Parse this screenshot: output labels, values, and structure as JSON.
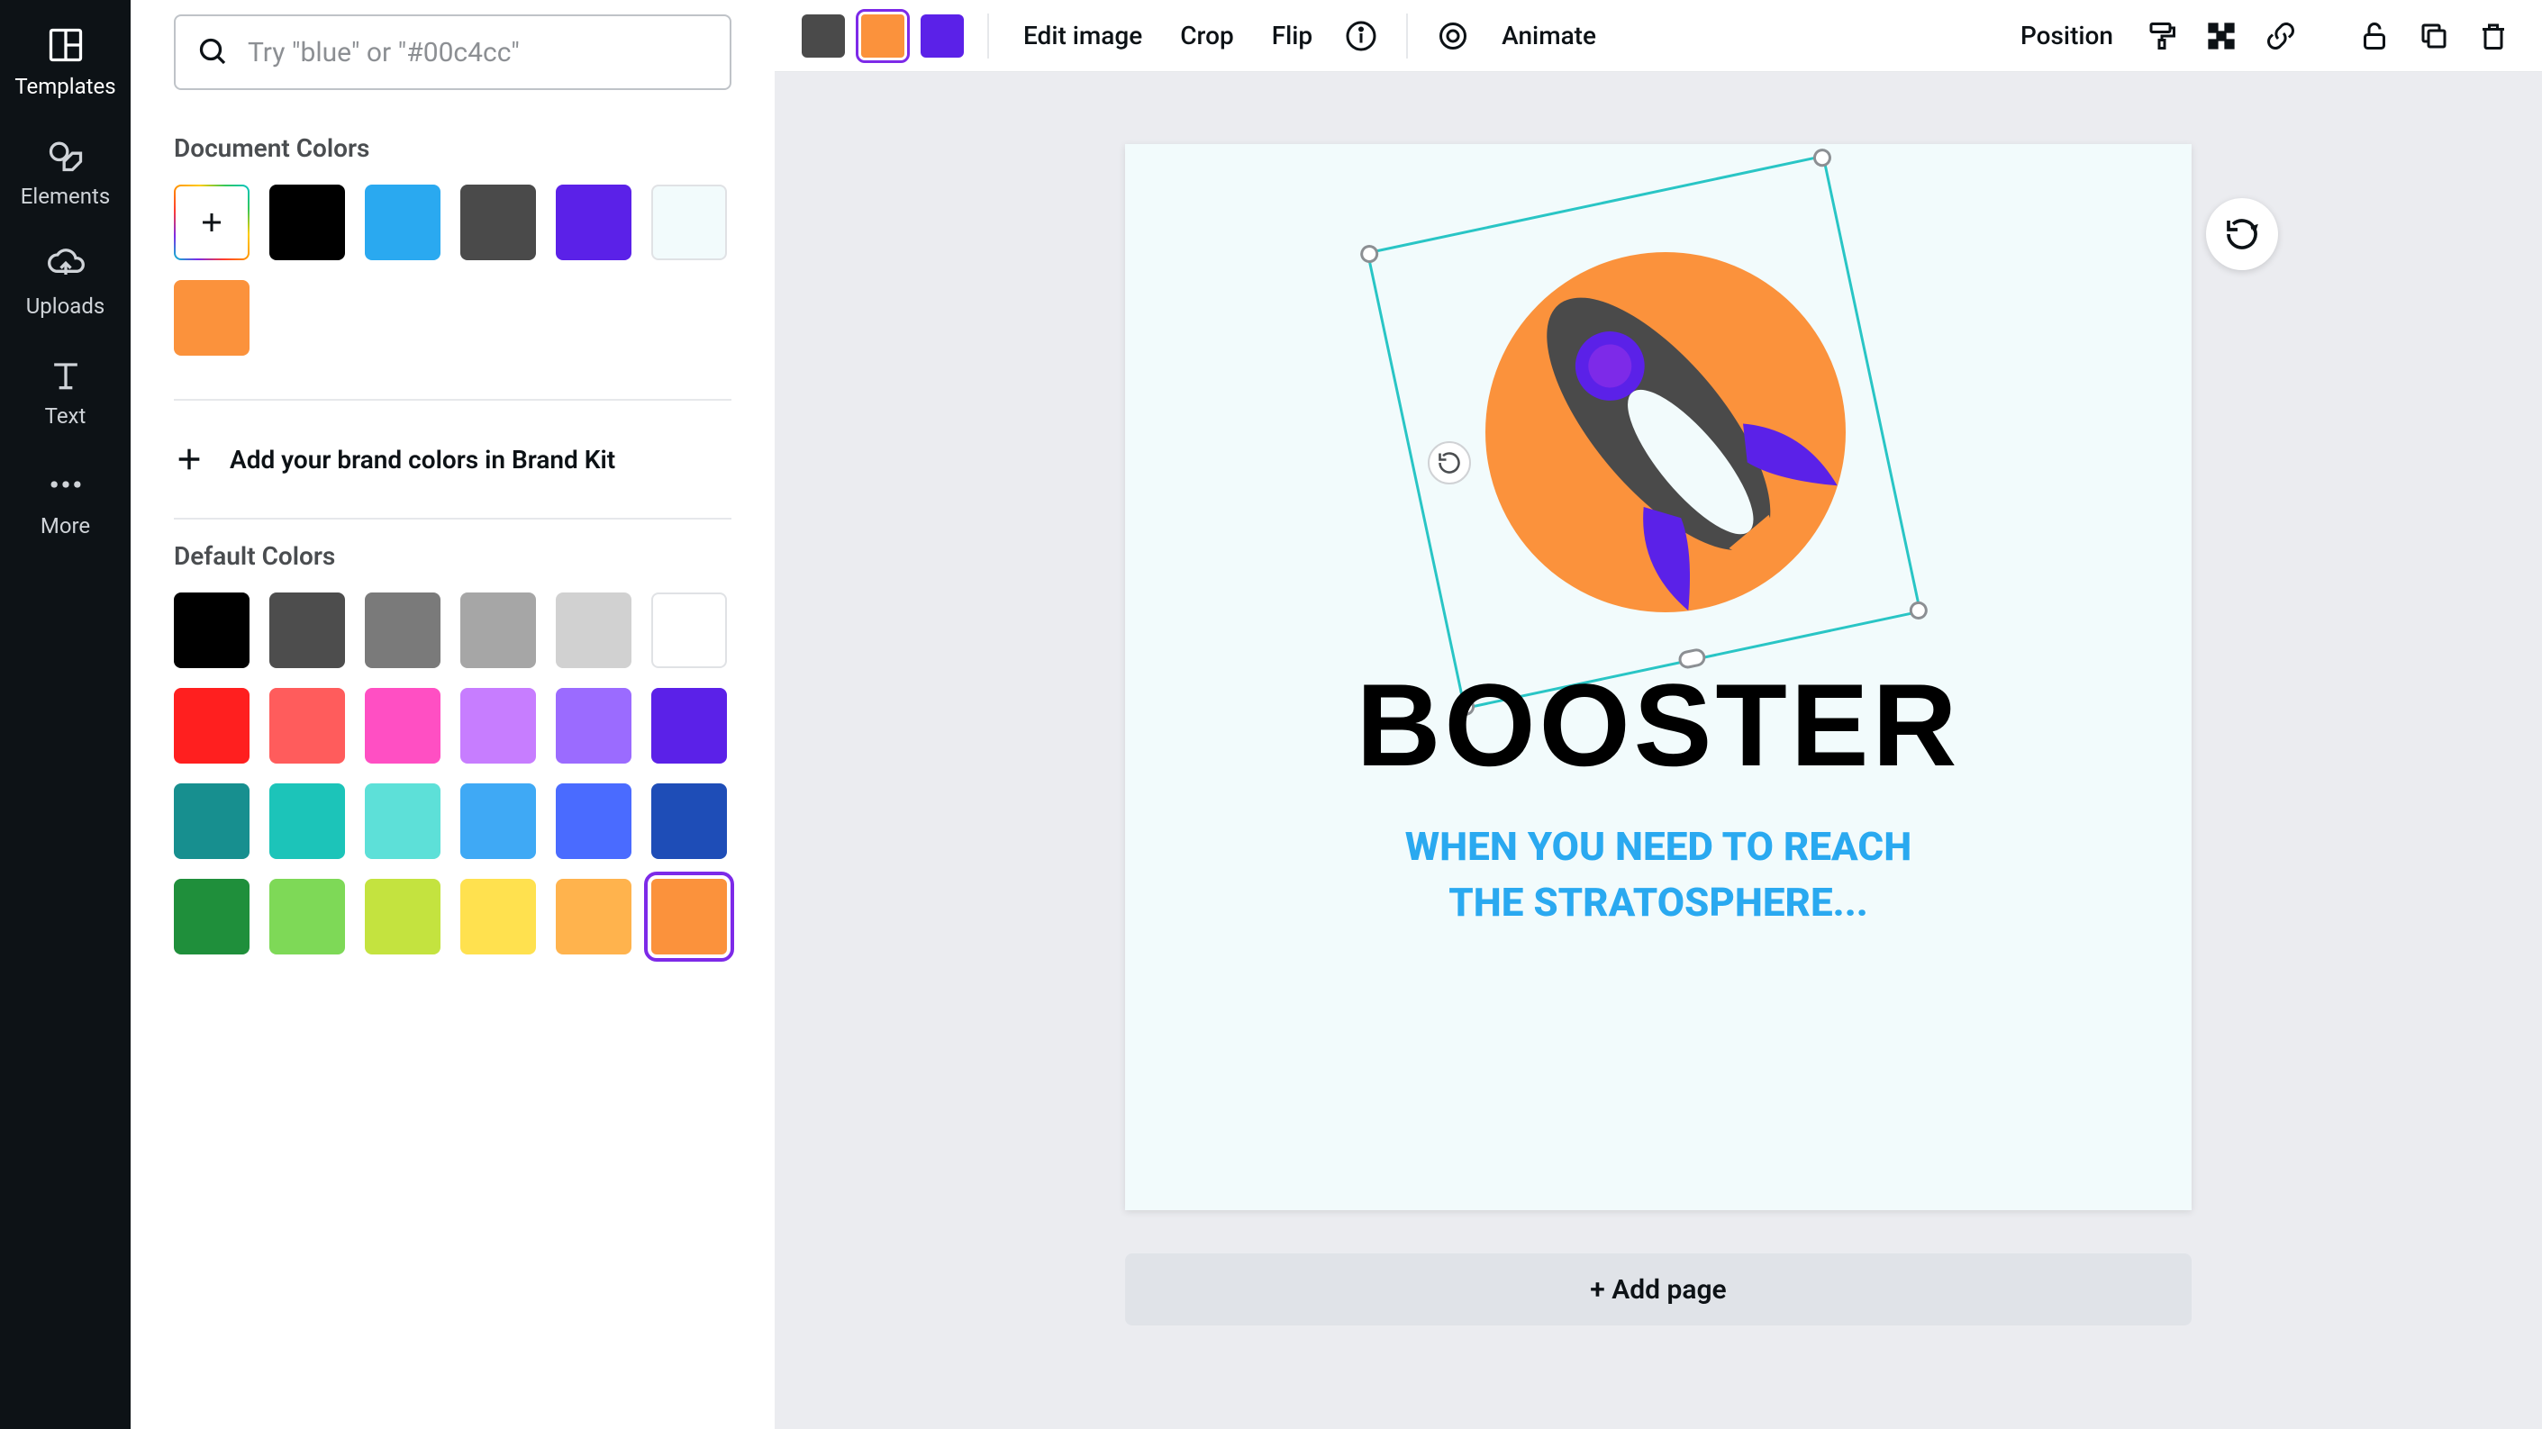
{
  "rail": {
    "templates": "Templates",
    "elements": "Elements",
    "uploads": "Uploads",
    "text": "Text",
    "more": "More"
  },
  "search": {
    "placeholder": "Try \"blue\" or \"#00c4cc\""
  },
  "sections": {
    "document_colors": "Document Colors",
    "brand_kit": "Add your brand colors in Brand Kit",
    "default_colors": "Default Colors"
  },
  "document_colors": [
    "#000000",
    "#2aa9f0",
    "#4a4a4a",
    "#5b21e8",
    "#f2fbfc",
    "#fb923c"
  ],
  "default_colors": [
    "#000000",
    "#4d4d4d",
    "#7a7a7a",
    "#a6a6a6",
    "#d1d1d1",
    "#ffffff",
    "#ff1f1f",
    "#ff5c5c",
    "#ff4fc3",
    "#c77dff",
    "#9b6bff",
    "#5b21e8",
    "#178f8f",
    "#1cc4b9",
    "#5de0d8",
    "#3fa9f5",
    "#4a6bff",
    "#1e4db7",
    "#1f8f3b",
    "#7ed957",
    "#c4e33f",
    "#ffe14f",
    "#ffb34d",
    "#fb923c"
  ],
  "default_colors_selected": 23,
  "toolbar": {
    "swatches": [
      "#4a4a4a",
      "#fb923c",
      "#5b21e8"
    ],
    "swatch_selected": 1,
    "edit_image": "Edit image",
    "crop": "Crop",
    "flip": "Flip",
    "animate": "Animate",
    "position": "Position"
  },
  "canvas": {
    "title": "BOOSTER",
    "subtitle_line1": "WHEN YOU NEED TO REACH",
    "subtitle_line2": "THE STRATOSPHERE...",
    "add_page": "+ Add page"
  }
}
